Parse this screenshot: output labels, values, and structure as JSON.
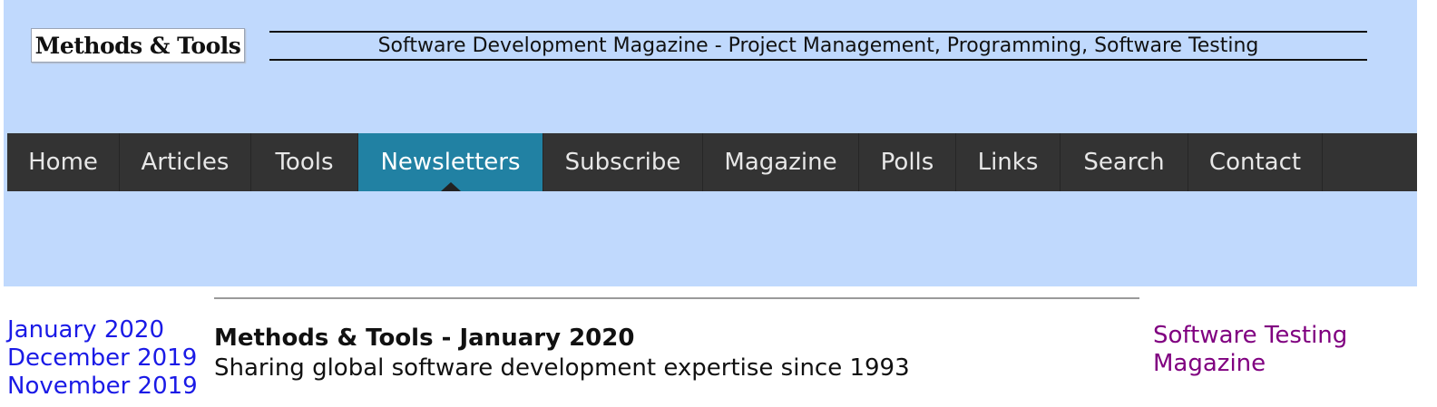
{
  "header": {
    "logo_text": "Methods & Tools",
    "tagline": "Software Development Magazine - Project Management, Programming, Software Testing",
    "background_color": "#c0d9fd"
  },
  "nav": {
    "items": [
      {
        "label": "Home",
        "active": false
      },
      {
        "label": "Articles",
        "active": false
      },
      {
        "label": "Tools",
        "active": false
      },
      {
        "label": "Newsletters",
        "active": true
      },
      {
        "label": "Subscribe",
        "active": false
      },
      {
        "label": "Magazine",
        "active": false
      },
      {
        "label": "Polls",
        "active": false
      },
      {
        "label": "Links",
        "active": false
      },
      {
        "label": "Search",
        "active": false
      },
      {
        "label": "Contact",
        "active": false
      }
    ],
    "background_color": "#333333",
    "active_color": "#2181a3"
  },
  "sidebar": {
    "archive_links": [
      "January 2020",
      "December 2019",
      "November 2019"
    ],
    "link_color": "#1a1ae6"
  },
  "main": {
    "title": "Methods & Tools - January 2020",
    "subtitle": "Sharing global software development expertise since 1993"
  },
  "right_sidebar": {
    "link": "Software Testing Magazine",
    "link_color": "#800080"
  }
}
